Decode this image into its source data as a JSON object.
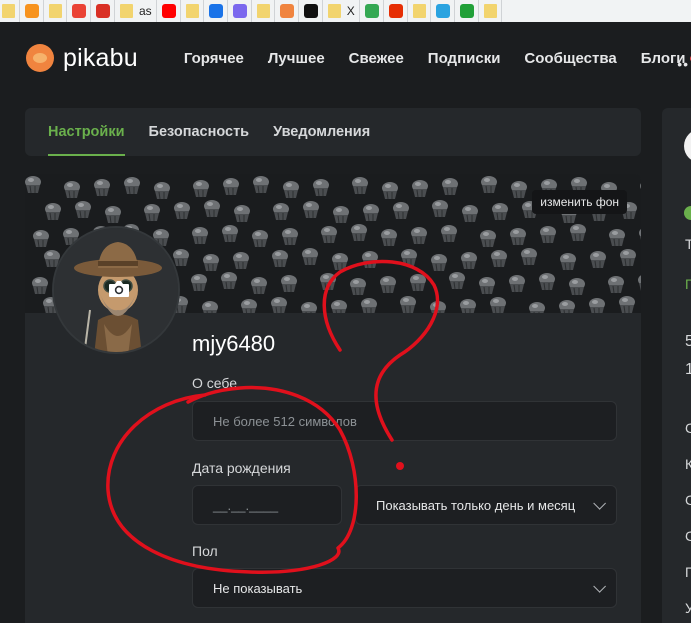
{
  "bookmarks": [
    {
      "icon": "folder-icon",
      "label": ""
    },
    {
      "icon": "odnoklassniki-icon",
      "label": ""
    },
    {
      "icon": "folder-icon",
      "label": ""
    },
    {
      "icon": "gmail-icon",
      "label": ""
    },
    {
      "icon": "mail-icon",
      "label": ""
    },
    {
      "icon": "folder-icon",
      "label": "as"
    },
    {
      "icon": "youtube-icon",
      "label": ""
    },
    {
      "icon": "folder-icon",
      "label": ""
    },
    {
      "icon": "blue-app-icon",
      "label": ""
    },
    {
      "icon": "puzzle-icon",
      "label": ""
    },
    {
      "icon": "folder-icon",
      "label": ""
    },
    {
      "icon": "orange-app-icon",
      "label": ""
    },
    {
      "icon": "t2-icon",
      "label": ""
    },
    {
      "icon": "folder-icon",
      "label": "X"
    },
    {
      "icon": "multicolor-icon",
      "label": ""
    },
    {
      "icon": "aliexpress-icon",
      "label": ""
    },
    {
      "icon": "folder-icon",
      "label": ""
    },
    {
      "icon": "telegram-icon",
      "label": ""
    },
    {
      "icon": "sber-icon",
      "label": ""
    },
    {
      "icon": "folder-icon",
      "label": ""
    }
  ],
  "header": {
    "logo_text": "pikabu",
    "nav": [
      "Горячее",
      "Лучшее",
      "Свежее",
      "Подписки",
      "Сообщества",
      "Блоги"
    ],
    "more": "••"
  },
  "tabs": [
    {
      "label": "Настройки",
      "active": true
    },
    {
      "label": "Безопасность",
      "active": false
    },
    {
      "label": "Уведомления",
      "active": false
    }
  ],
  "profile": {
    "change_cover": "изменить фон",
    "username": "mjy6480",
    "about_label": "О себе",
    "about_placeholder": "Не более 512 символов",
    "birth_label": "Дата рождения",
    "birth_placeholder": "__.__.____",
    "birth_visibility": "Показывать только день и месяц",
    "gender_label": "Пол",
    "gender_value": "Не показывать"
  },
  "sidebar_fragments": [
    "Т",
    "П",
    "5",
    "1",
    "С",
    "К",
    "С",
    "С",
    "П",
    "У"
  ],
  "colors": {
    "accent_green": "#6ab04c",
    "logo_orange": "#f0843f",
    "background": "#1b1d1f",
    "card": "#25282b",
    "annotation_red": "#e0101c"
  }
}
